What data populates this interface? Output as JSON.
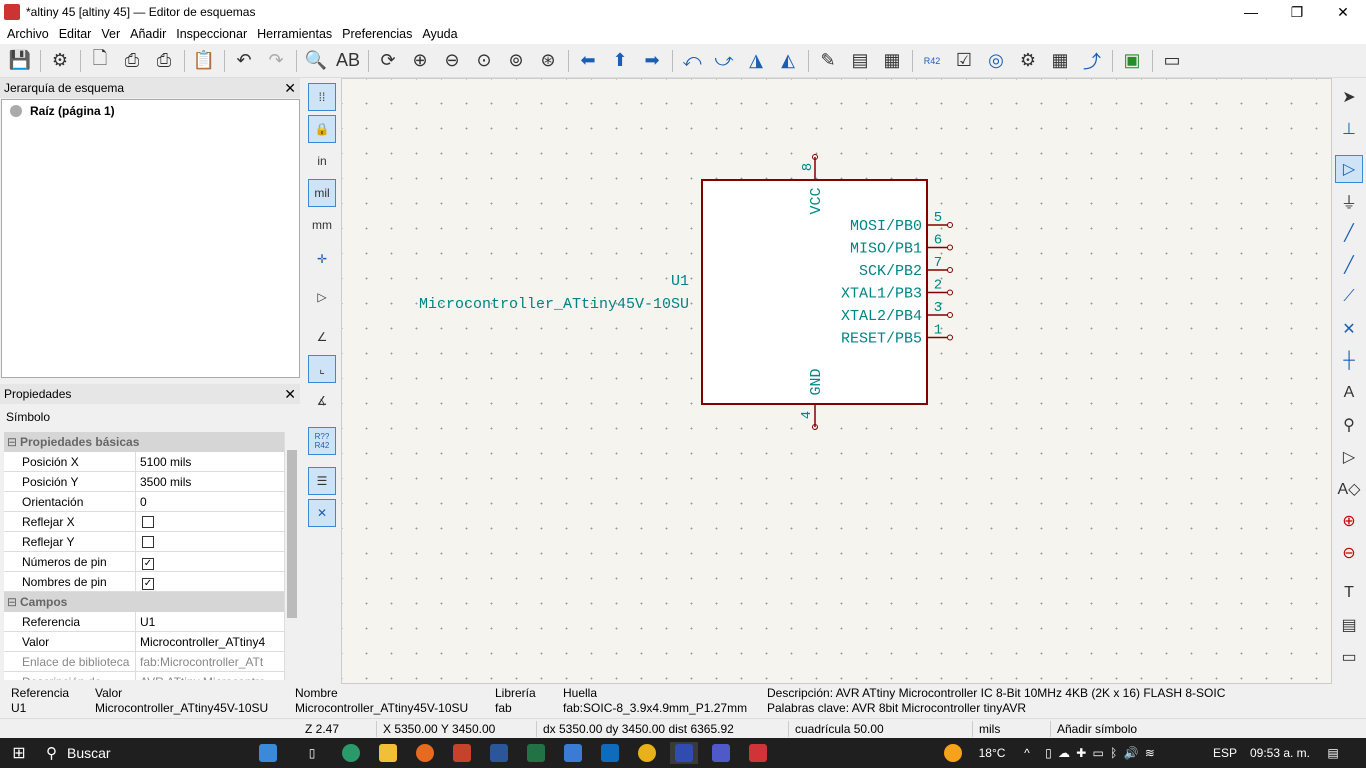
{
  "window": {
    "title": "*altiny 45 [altiny 45] — Editor de esquemas",
    "minimize": "—",
    "maximize": "❐",
    "close": "✕"
  },
  "menu": [
    "Archivo",
    "Editar",
    "Ver",
    "Añadir",
    "Inspeccionar",
    "Herramientas",
    "Preferencias",
    "Ayuda"
  ],
  "hierarchy": {
    "header": "Jerarquía de esquema",
    "close": "✕",
    "root": "Raíz (página 1)"
  },
  "properties": {
    "header": "Propiedades",
    "close": "✕",
    "subtitle": "Símbolo",
    "group_basic": "Propiedades básicas",
    "group_fields": "Campos",
    "toggle": "⊟",
    "rows_basic": [
      {
        "k": "Posición X",
        "v": "5100 mils"
      },
      {
        "k": "Posición Y",
        "v": "3500 mils"
      },
      {
        "k": "Orientación",
        "v": "0"
      },
      {
        "k": "Reflejar X",
        "v": ""
      },
      {
        "k": "Reflejar Y",
        "v": ""
      },
      {
        "k": "Números de pin",
        "v": "✓"
      },
      {
        "k": "Nombres de pin",
        "v": "✓"
      }
    ],
    "rows_fields": [
      {
        "k": "Referencia",
        "v": "U1"
      },
      {
        "k": "Valor",
        "v": "Microcontroller_ATtiny4"
      },
      {
        "k": "Enlace de biblioteca",
        "v": "fab:Microcontroller_ATt"
      },
      {
        "k": "Descripción de biblioteca",
        "v": "AVR ATtiny Microcontro"
      }
    ]
  },
  "left_tools": {
    "units_in": "in",
    "units_mil": "mil",
    "units_mm": "mm",
    "annotate": "R??\nR42"
  },
  "schematic": {
    "ref": "U1",
    "value": "Microcontroller_ATtiny45V-10SU",
    "top_pin": {
      "num": "8",
      "name": "VCC"
    },
    "bottom_pin": {
      "num": "4",
      "name": "GND"
    },
    "right_pins": [
      {
        "num": "5",
        "name": "MOSI/PB0"
      },
      {
        "num": "6",
        "name": "MISO/PB1"
      },
      {
        "num": "7",
        "name": "SCK/PB2"
      },
      {
        "num": "2",
        "name": "XTAL1/PB3"
      },
      {
        "num": "3",
        "name": "XTAL2/PB4"
      },
      {
        "num": "1",
        "name": "RESET/PB5"
      }
    ]
  },
  "infobar": {
    "ref_label": "Referencia",
    "ref_value": "U1",
    "val_label": "Valor",
    "val_value": "Microcontroller_ATtiny45V-10SU",
    "name_label": "Nombre",
    "name_value": "Microcontroller_ATtiny45V-10SU",
    "lib_label": "Librería",
    "lib_value": "fab",
    "fp_label": "Huella",
    "fp_value": "fab:SOIC-8_3.9x4.9mm_P1.27mm",
    "desc": "Descripción: AVR ATtiny Microcontroller IC 8-Bit 10MHz 4KB (2K x 16) FLASH 8-SOIC",
    "keywords": "Palabras clave: AVR 8bit Microcontroller tinyAVR"
  },
  "status": {
    "zoom": "Z 2.47",
    "xy": "X 5350.00  Y 3450.00",
    "dxy": "dx 5350.00  dy 3450.00  dist 6365.92",
    "grid": "cuadrícula 50.00",
    "units": "mils",
    "mode": "Añadir símbolo"
  },
  "taskbar": {
    "search": "Buscar",
    "weather": "18°C",
    "lang": "ESP",
    "time": "09:53 a. m."
  },
  "colors": {
    "canvas_bg": "#f5f4ef",
    "symbol_body": "#840000",
    "pin_text": "#008484",
    "accent": "#1a5fb4"
  }
}
